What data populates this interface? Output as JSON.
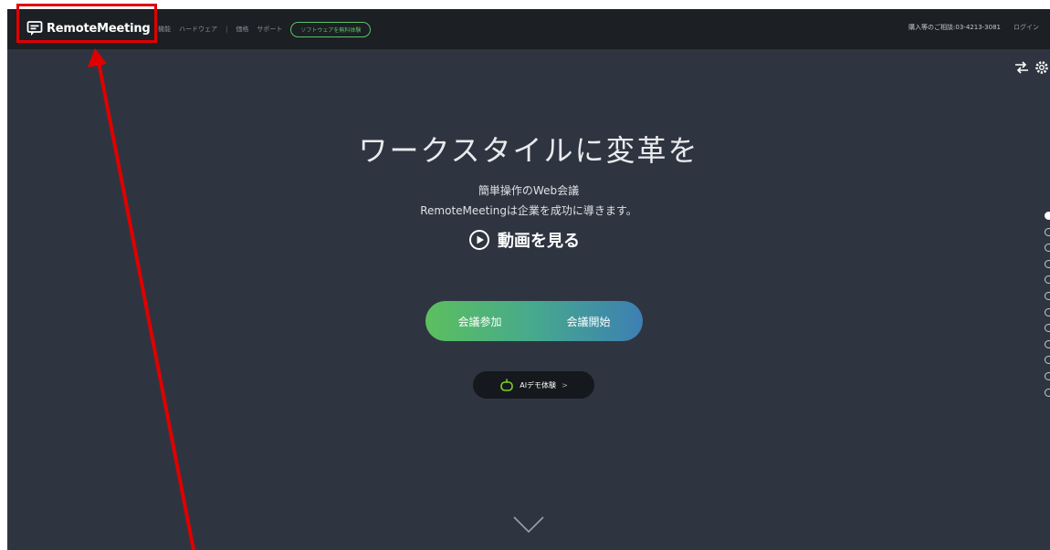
{
  "header": {
    "logo_text": "RemoteMeeting",
    "nav": [
      {
        "label": "機能"
      },
      {
        "label": "ハードウェア"
      },
      {
        "label": "価格"
      },
      {
        "label": "サポート"
      }
    ],
    "trial_label": "ソフトウェアを無料体験",
    "contact": "購入等のご相談:03-4213-3081",
    "login": "ログイン"
  },
  "hero": {
    "title": "ワークスタイルに変革を",
    "subtitle_line1": "簡単操作のWeb会議",
    "subtitle_line2": "RemoteMeetingは企業を成功に導きます。",
    "video_label": "動画を見る",
    "join_label": "会議参加",
    "start_label": "会議開始",
    "ai_label": "AIデモ体験",
    "ai_chevron": ">"
  },
  "icons": {
    "translate": "translate-icon",
    "settings": "gear-icon",
    "play": "play-circle-icon",
    "robot": "robot-icon",
    "scroll": "chevron-down-icon"
  },
  "pagination": {
    "total": 12,
    "active_index": 0
  },
  "colors": {
    "background": "#2e3541",
    "topbar": "#1c1f23",
    "accent_green": "#59c26a",
    "accent_blue": "#3d7fb3",
    "highlight_red": "#e00000"
  }
}
